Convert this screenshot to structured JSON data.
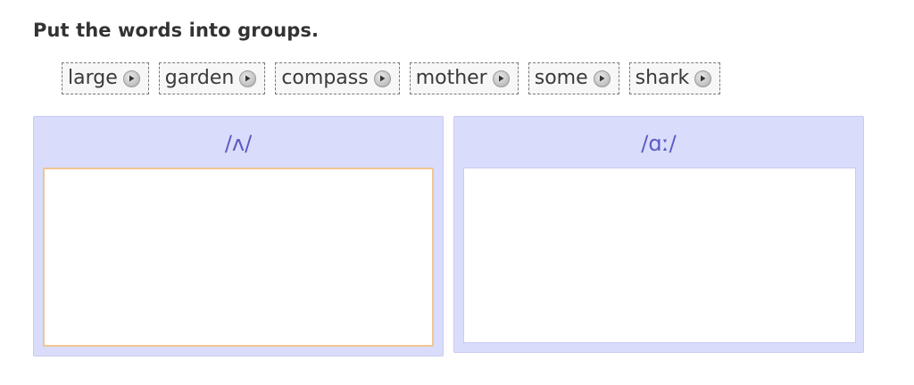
{
  "instruction": "Put the words into groups.",
  "words": [
    {
      "label": "large",
      "audio_icon": "play-icon"
    },
    {
      "label": "garden",
      "audio_icon": "play-icon"
    },
    {
      "label": "compass",
      "audio_icon": "play-icon"
    },
    {
      "label": "mother",
      "audio_icon": "play-icon"
    },
    {
      "label": "some",
      "audio_icon": "play-icon"
    },
    {
      "label": "shark",
      "audio_icon": "play-icon"
    }
  ],
  "groups": [
    {
      "label": "/ʌ/",
      "items": [],
      "state": "focused"
    },
    {
      "label": "/ɑː/",
      "items": []
    }
  ],
  "colors": {
    "group_bg": "#dadcfb",
    "group_header_text": "#5a5cc4",
    "focused_drop_zone_border": "#f1c592"
  }
}
